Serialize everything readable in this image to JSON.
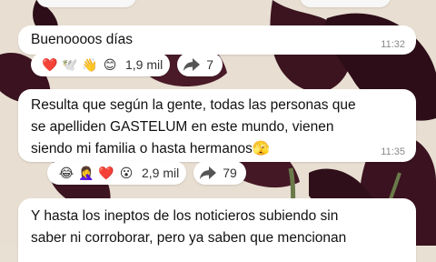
{
  "messages": [
    {
      "text": "Buenoooos días",
      "time": "11:32",
      "reactions": [
        "❤️",
        "🕊️",
        "👋",
        "😊"
      ],
      "reaction_count": "1,9 mil",
      "forward_count": "7"
    },
    {
      "text": "Resulta que según la gente, todas las personas que\nse apelliden GASTELUM en este mundo, vienen\nsiendo mi familia o hasta hermanos🫣",
      "time": "11:35",
      "reactions": [
        "😂",
        "🤦‍♀️",
        "❤️",
        "😮"
      ],
      "reaction_count": "2,9 mil",
      "forward_count": "79"
    },
    {
      "text": "Y hasta los ineptos de los noticieros subiendo sin\nsaber ni corroborar, pero ya saben que mencionan"
    }
  ],
  "colors": {
    "bubble": "#ffffff",
    "time": "#8a8a8a",
    "forward_icon": "#555555"
  }
}
